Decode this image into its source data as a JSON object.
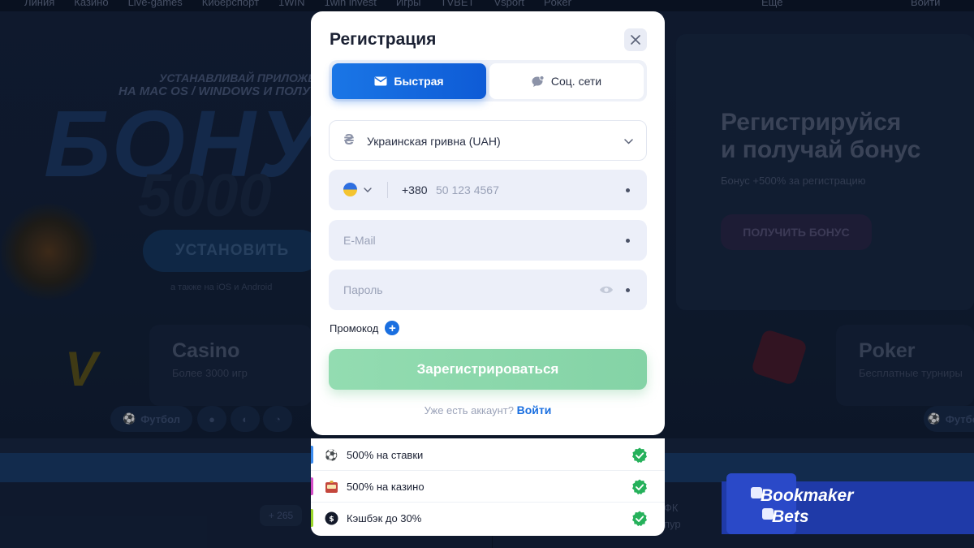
{
  "background": {
    "nav": [
      "Линия",
      "Казино",
      "Live-games",
      "Киберспорт",
      "1WIN",
      "1win invest",
      "Игры",
      "TVBET",
      "Vsport",
      "Poker",
      "Еще",
      "Войти"
    ],
    "promo_left": {
      "line1": "УСТАНАВЛИВАЙ ПРИЛОЖЕНИЕ",
      "line2": "НА MAC OS / WINDOWS И ПОЛУЧИ",
      "big1": "БОНУС",
      "big2": "5000",
      "install": "УСТАНОВИТЬ",
      "small": "а также на iOS и Android"
    },
    "promo_right": {
      "title_line1": "Регистрируйся",
      "title_line2": "и получай бонус",
      "sub": "Бонус +500% за регистрацию",
      "button": "ПОЛУЧИТЬ БОНУС"
    },
    "cards": [
      {
        "title": "Casino",
        "sub": "Более 3000 игр"
      },
      {
        "title": "Poker",
        "sub": "Бесплатные турниры"
      }
    ],
    "sports": [
      "Футбол",
      "Футбол"
    ],
    "lower": {
      "badge": "+ 265",
      "text1": "ФК",
      "text2": "пур"
    },
    "watermark": {
      "line1": "Bookmaker",
      "line2": "Bets"
    }
  },
  "modal": {
    "title": "Регистрация",
    "tabs": [
      {
        "label": "Быстрая",
        "icon": "envelope-icon",
        "active": true
      },
      {
        "label": "Соц. сети",
        "icon": "chat-bubble-icon",
        "active": false
      }
    ],
    "currency": {
      "symbol": "₴",
      "value": "Украинская гривна (UAH)"
    },
    "phone": {
      "code": "+380",
      "placeholder": "50 123 4567"
    },
    "email": {
      "placeholder": "E-Mail"
    },
    "password": {
      "placeholder": "Пароль"
    },
    "promo_label": "Промокод",
    "submit_label": "Зарегистрироваться",
    "login_prompt": "Уже есть аккаунт?",
    "login_link": "Войти"
  },
  "bonuses": [
    {
      "text": "500% на ставки",
      "icon": "soccer-ball-icon",
      "bar_color": "#3b8cf0"
    },
    {
      "text": "500% на казино",
      "icon": "slot-machine-icon",
      "bar_color": "#d44ec8"
    },
    {
      "text": "Кэшбэк до 30%",
      "icon": "cashback-icon",
      "bar_color": "#9ad62a"
    }
  ],
  "colors": {
    "accent": "#1a6fe0",
    "success": "#26b15b",
    "submit": "#88d6a9"
  }
}
